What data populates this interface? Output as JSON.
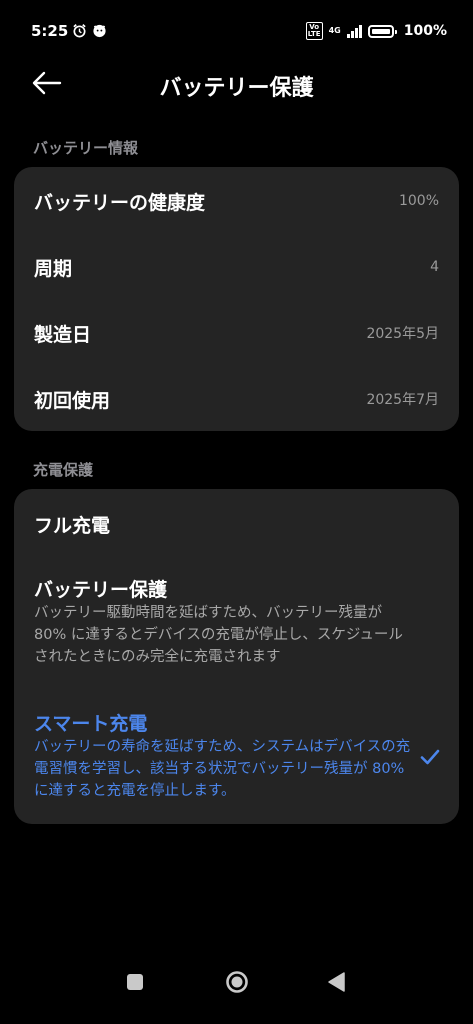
{
  "status_bar": {
    "time": "5:25",
    "network": "4G",
    "battery": "100%"
  },
  "header": {
    "title": "バッテリー保護"
  },
  "battery_info": {
    "section_title": "バッテリー情報",
    "rows": [
      {
        "label": "バッテリーの健康度",
        "value": "100%"
      },
      {
        "label": "周期",
        "value": "4"
      },
      {
        "label": "製造日",
        "value": "2025年5月"
      },
      {
        "label": "初回使用",
        "value": "2025年7月"
      }
    ]
  },
  "charging_protection": {
    "section_title": "充電保護",
    "options": [
      {
        "title": "フル充電",
        "description": ""
      },
      {
        "title": "バッテリー保護",
        "description": "バッテリー駆動時間を延ばすため、バッテリー残量が 80% に達するとデバイスの充電が停止し、スケジュールされたときにのみ完全に充電されます"
      },
      {
        "title": "スマート充電",
        "description": "バッテリーの寿命を延ばすため、システムはデバイスの充電習慣を学習し、該当する状況でバッテリー残量が 80% に達すると充電を停止します。",
        "selected": true
      }
    ]
  },
  "colors": {
    "accent": "#4c86ec",
    "card": "#242424",
    "background": "#000000"
  },
  "icons": {
    "back": "back-arrow-icon",
    "check": "check-icon",
    "nav": [
      "recents-square-icon",
      "home-circle-icon",
      "back-triangle-icon"
    ]
  }
}
